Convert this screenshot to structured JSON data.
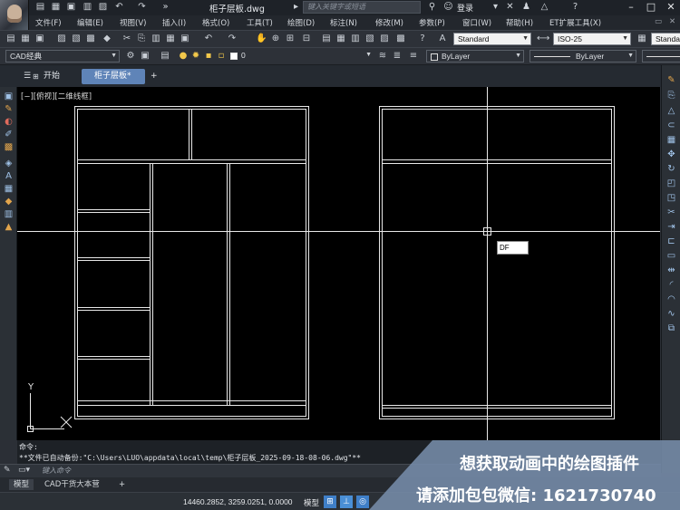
{
  "title_bar": {
    "document_title": "柜子层板.dwg",
    "search_placeholder": "键入关键字或短语",
    "login_label": "登录"
  },
  "menu": [
    "文件(F)",
    "编辑(E)",
    "视图(V)",
    "插入(I)",
    "格式(O)",
    "工具(T)",
    "绘图(D)",
    "标注(N)",
    "修改(M)",
    "参数(P)",
    "窗口(W)",
    "帮助(H)",
    "ET扩展工具(X)"
  ],
  "toolbar": {
    "text_style": "Standard",
    "dim_style": "ISO-25",
    "table_style": "Standa",
    "workspace": "CAD经典",
    "layer": "0",
    "color": "ByLayer",
    "linetype": "ByLayer",
    "lineweight": "ByLayer"
  },
  "tabs": {
    "start": "开始",
    "file": "柜子层板*",
    "add": "+"
  },
  "canvas": {
    "view_label": "[−][俯视][二维线框]",
    "dynamic_input": "DF",
    "ucs_y": "Y",
    "ucs_x": "X"
  },
  "command": {
    "line1": "命令:",
    "line2": "**文件已自动备份:\"C:\\Users\\LUO\\appdata\\local\\temp\\柜子层板_2025-09-18-08-06.dwg\"**",
    "input_placeholder": "键入命令"
  },
  "layout_tabs": [
    "模型",
    "CAD干货大本营",
    "+"
  ],
  "status": {
    "coordinates": "14460.2852, 3259.0251, 0.0000",
    "model": "模型"
  },
  "promo": {
    "line1": "想获取动画中的绘图插件",
    "line2": "请添加包包微信: 1621730740"
  },
  "colors": {
    "accent": "#5f84b8",
    "canvas_bg": "#000000",
    "drawing_lines": "#ffffff"
  }
}
